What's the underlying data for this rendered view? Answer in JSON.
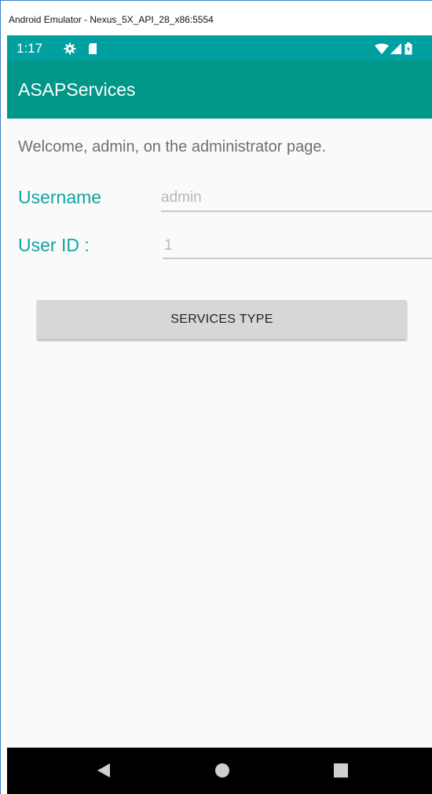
{
  "window": {
    "title": "Android Emulator - Nexus_5X_API_28_x86:5554"
  },
  "status_bar": {
    "time": "1:17",
    "icons": [
      "settings-gear-icon",
      "sd-card-icon",
      "wifi-icon",
      "signal-icon",
      "battery-icon"
    ],
    "background_color": "#00a0a0"
  },
  "app_bar": {
    "title": "ASAPServices",
    "background_color": "#009688"
  },
  "main": {
    "welcome_text": "Welcome, admin, on the administrator page.",
    "fields": [
      {
        "label": "Username",
        "value": "admin"
      },
      {
        "label": "User ID :",
        "value": "1"
      }
    ],
    "button_label": "SERVICES TYPE",
    "accent_color": "#13a3a3"
  },
  "nav_bar": {
    "icons": [
      "back-icon",
      "home-icon",
      "recents-icon"
    ]
  }
}
